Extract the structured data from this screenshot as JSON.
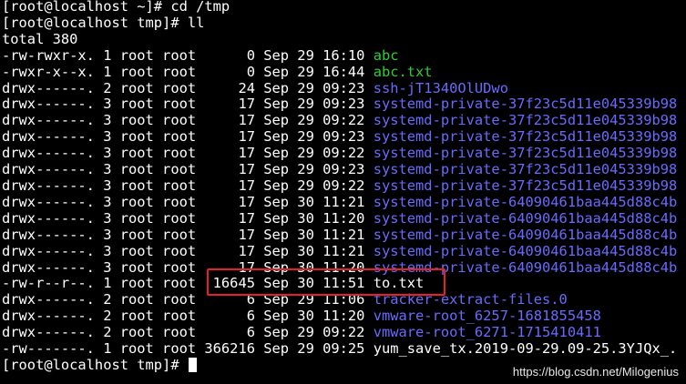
{
  "colors": {
    "background": "#000000",
    "foreground": "#ffffff",
    "executable": "#33cc33",
    "directory": "#6a6aff",
    "highlight_box": "#e52127",
    "cursor": "#ffffff"
  },
  "terminal": {
    "lines": [
      {
        "prefix": "[root@localhost ~]# cd /tmp",
        "name": "",
        "color": "white"
      },
      {
        "prefix": "[root@localhost tmp]# ll",
        "name": "",
        "color": "white"
      },
      {
        "prefix": "total 380",
        "name": "",
        "color": "white"
      },
      {
        "prefix": "-rw-rwxr-x. 1 root root      0 Sep 29 16:10 ",
        "name": "abc",
        "color": "green"
      },
      {
        "prefix": "-rwxr-x--x. 1 root root      0 Sep 29 16:44 ",
        "name": "abc.txt",
        "color": "green"
      },
      {
        "prefix": "drwx------. 2 root root     24 Sep 29 09:23 ",
        "name": "ssh-jT1340OlUDwo",
        "color": "blue"
      },
      {
        "prefix": "drwx------. 3 root root     17 Sep 29 09:23 ",
        "name": "systemd-private-37f23c5d11e045339b98",
        "color": "blue"
      },
      {
        "prefix": "drwx------. 3 root root     17 Sep 29 09:22 ",
        "name": "systemd-private-37f23c5d11e045339b98",
        "color": "blue"
      },
      {
        "prefix": "drwx------. 3 root root     17 Sep 29 09:23 ",
        "name": "systemd-private-37f23c5d11e045339b98",
        "color": "blue"
      },
      {
        "prefix": "drwx------. 3 root root     17 Sep 29 09:22 ",
        "name": "systemd-private-37f23c5d11e045339b98",
        "color": "blue"
      },
      {
        "prefix": "drwx------. 3 root root     17 Sep 29 09:23 ",
        "name": "systemd-private-37f23c5d11e045339b98",
        "color": "blue"
      },
      {
        "prefix": "drwx------. 3 root root     17 Sep 29 09:22 ",
        "name": "systemd-private-37f23c5d11e045339b98",
        "color": "blue"
      },
      {
        "prefix": "drwx------. 3 root root     17 Sep 30 11:21 ",
        "name": "systemd-private-64090461baa445d88c4b",
        "color": "blue"
      },
      {
        "prefix": "drwx------. 3 root root     17 Sep 30 11:20 ",
        "name": "systemd-private-64090461baa445d88c4b",
        "color": "blue"
      },
      {
        "prefix": "drwx------. 3 root root     17 Sep 30 11:21 ",
        "name": "systemd-private-64090461baa445d88c4b",
        "color": "blue"
      },
      {
        "prefix": "drwx------. 3 root root     17 Sep 30 11:21 ",
        "name": "systemd-private-64090461baa445d88c4b",
        "color": "blue"
      },
      {
        "prefix": "drwx------. 3 root root     17 Sep 30 11:20 ",
        "name": "systemd-private-64090461baa445d88c4b",
        "color": "blue"
      },
      {
        "prefix": "-rw-r--r--. 1 root root  16645 Sep 30 11:51 ",
        "name": "to.txt",
        "color": "white"
      },
      {
        "prefix": "drwx------. 2 root root      6 Sep 29 11:06 ",
        "name": "tracker-extract-files.0",
        "color": "blue"
      },
      {
        "prefix": "drwx------. 2 root root      6 Sep 30 11:20 ",
        "name": "vmware-root_6257-1681855458",
        "color": "blue"
      },
      {
        "prefix": "drwx------. 2 root root      6 Sep 29 09:22 ",
        "name": "vmware-root_6271-1715410411",
        "color": "blue"
      },
      {
        "prefix": "-rw-------. 1 root root 366216 Sep 29 09:25 ",
        "name": "yum_save_tx.2019-09-29.09-25.3YJQx_.",
        "color": "white"
      }
    ],
    "prompt": "[root@localhost tmp]# "
  },
  "watermark": "https://blog.csdn.net/Milogenius"
}
